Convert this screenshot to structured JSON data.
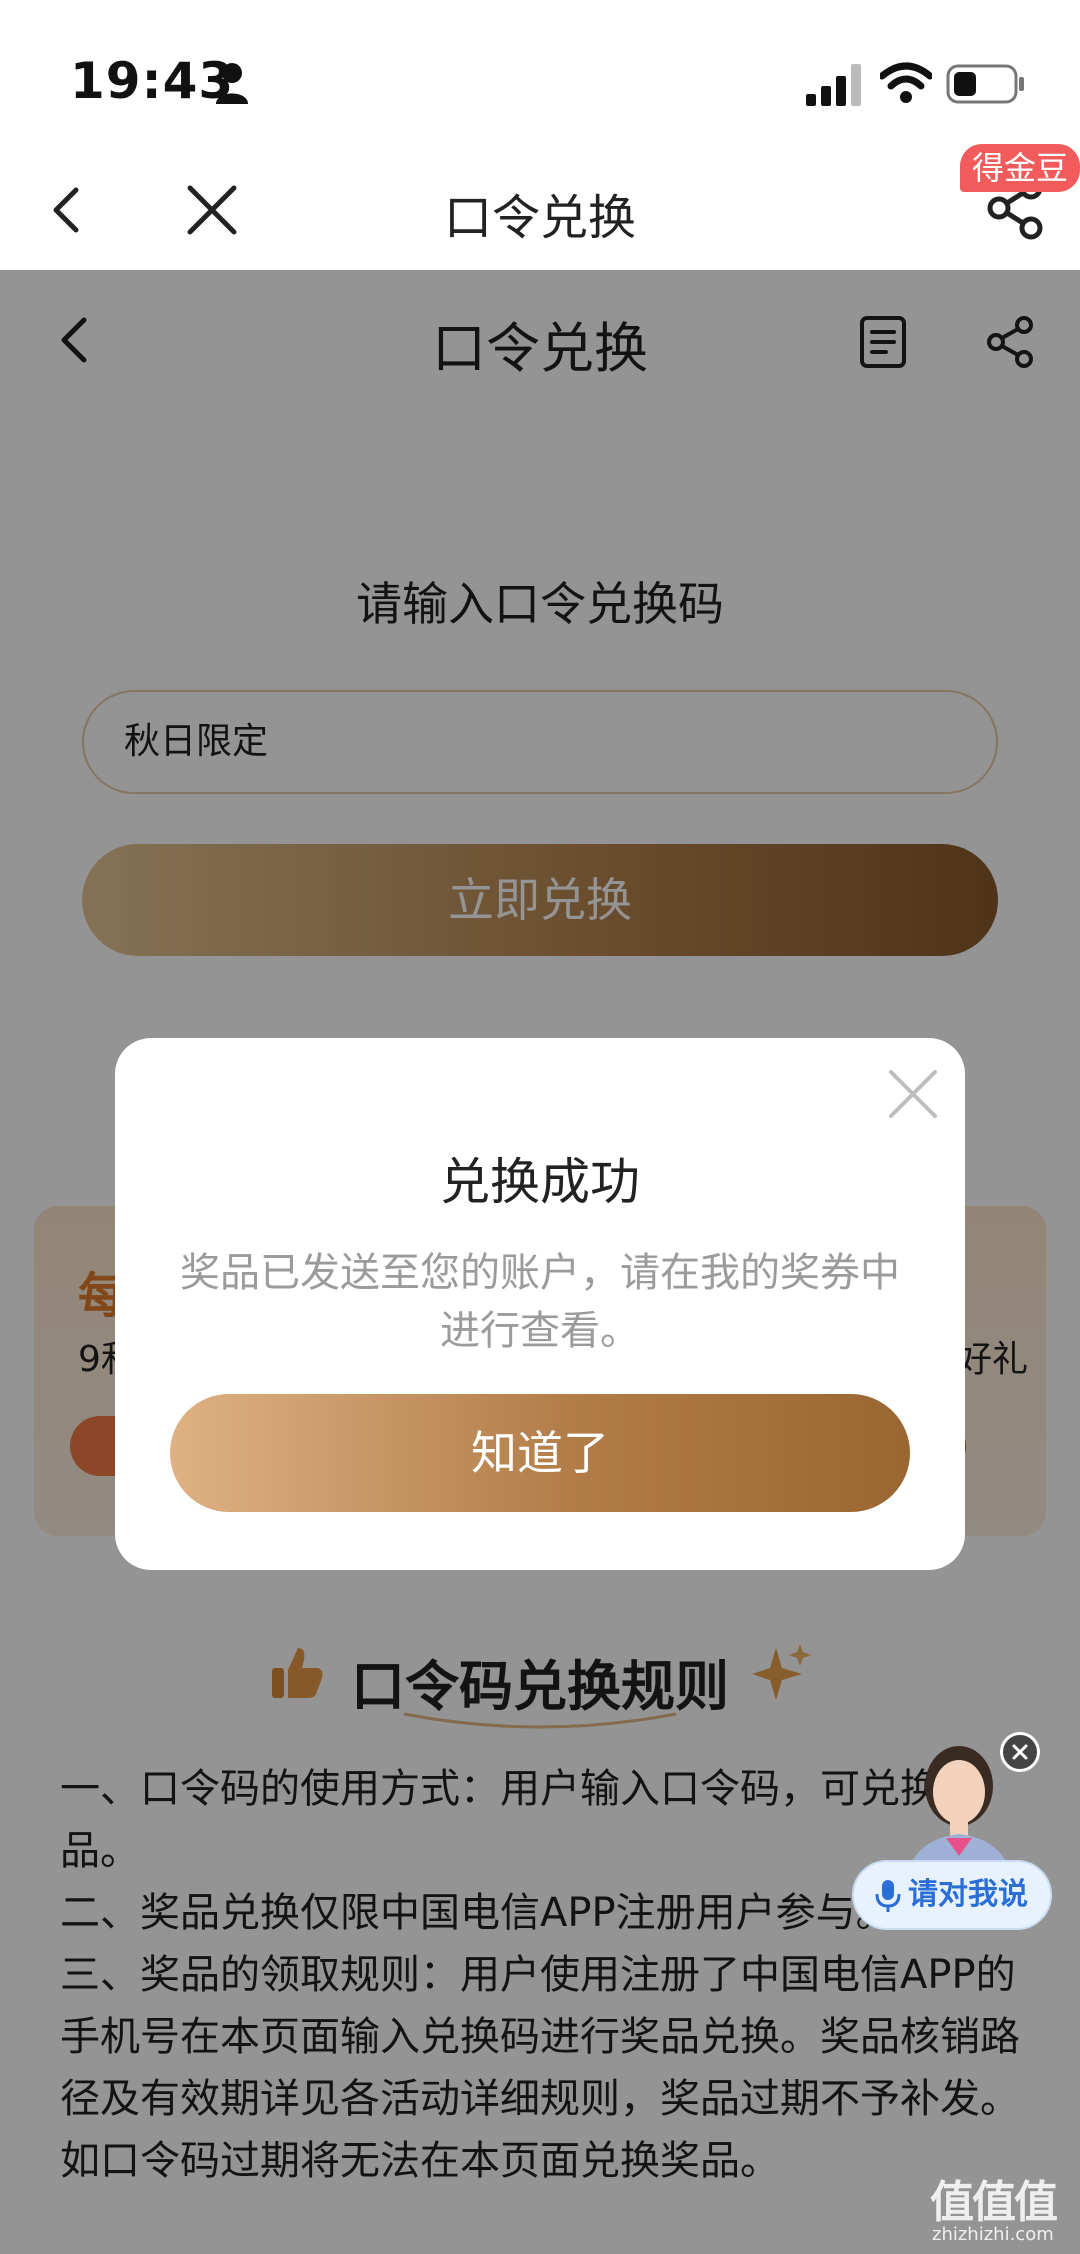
{
  "status_bar": {
    "time": "19:43"
  },
  "outer_nav": {
    "title": "口令兑换",
    "badge": "得金豆"
  },
  "inner_nav": {
    "title": "口令兑换"
  },
  "form": {
    "prompt": "请输入口令兑换码",
    "input_value": "秋日限定",
    "submit_label": "立即兑换"
  },
  "promo": {
    "title": "每",
    "subtitle": "9和",
    "right_text": "袋好礼"
  },
  "rules": {
    "heading": "口令码兑换规则",
    "lines": [
      "一、口令码的使用方式：用户输入口令码，可兑换奖品。",
      "二、奖品兑换仅限中国电信APP注册用户参与。",
      "三、奖品的领取规则：用户使用注册了中国电信APP的手机号在本页面输入兑换码进行奖品兑换。奖品核销路径及有效期详见各活动详细规则，奖品过期不予补发。如口令码过期将无法在本页面兑换奖品。"
    ]
  },
  "modal": {
    "title": "兑换成功",
    "message": "奖品已发送至您的账户，请在我的奖券中进行查看。",
    "ok_label": "知道了"
  },
  "assistant": {
    "label": "请对我说"
  },
  "watermark": {
    "main": "值值值",
    "sub": "zhizhizhi.com"
  },
  "colors": {
    "accent_gold": "#b78751",
    "badge_red": "#f25b5b",
    "assistant_blue": "#2b6fd6"
  }
}
